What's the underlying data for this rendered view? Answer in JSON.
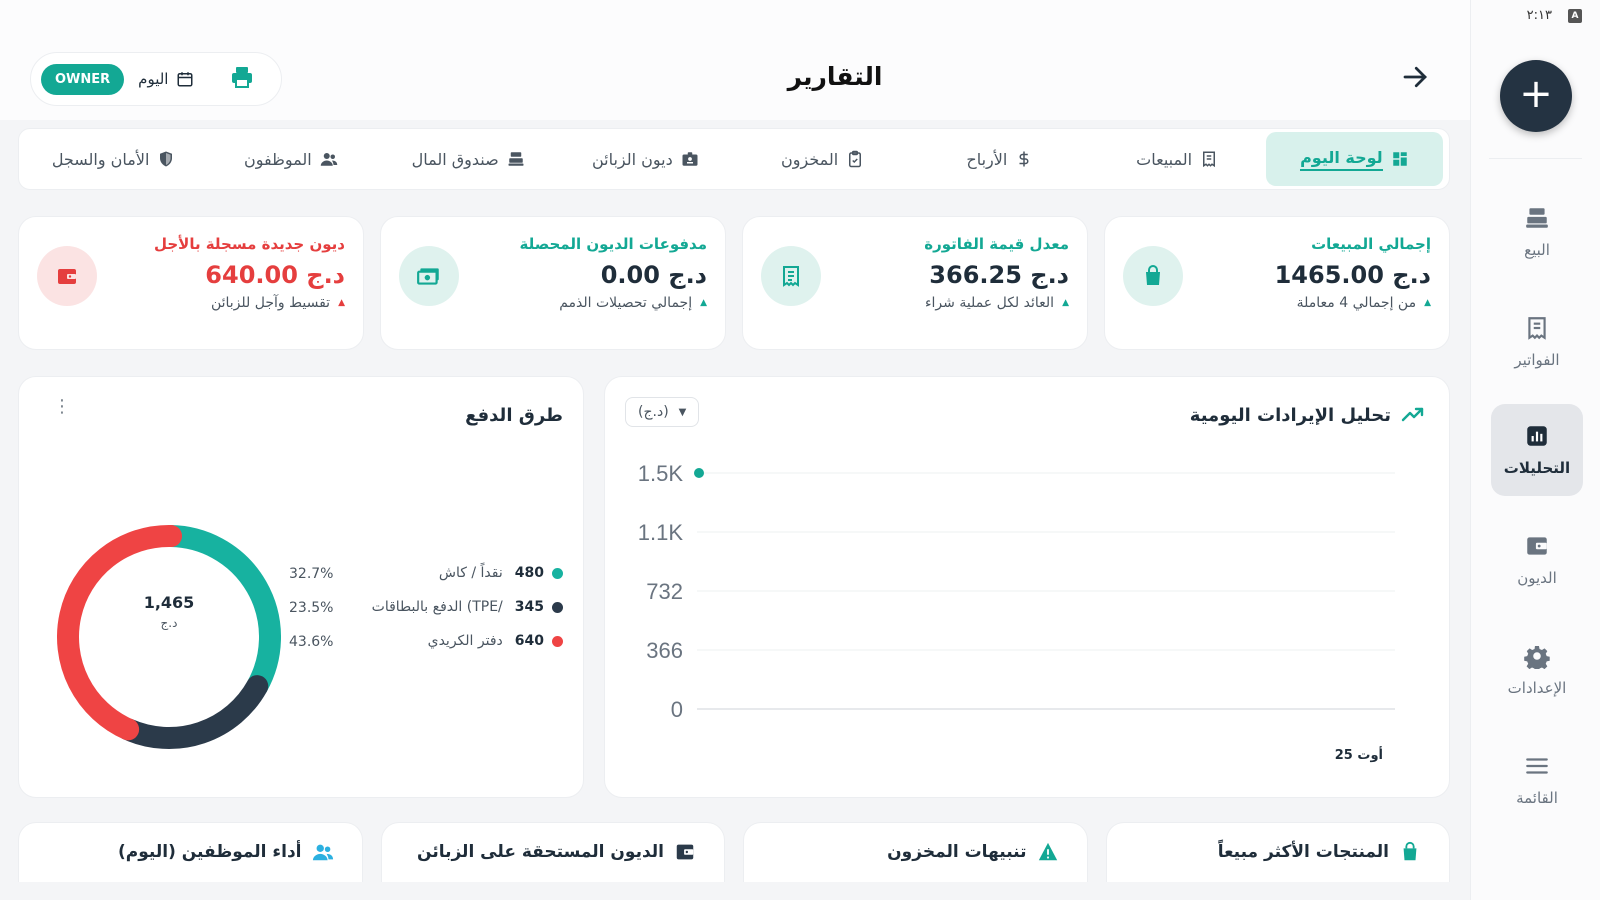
{
  "status_bar": {
    "time": "٢:١٣",
    "indicator": "A"
  },
  "header": {
    "title": "التقارير",
    "owner_badge": "OWNER",
    "date_filter": "اليوم"
  },
  "tabs": [
    {
      "label": "لوحة اليوم",
      "icon": "dashboard-icon",
      "active": true
    },
    {
      "label": "المبيعات",
      "icon": "receipt-icon",
      "active": false
    },
    {
      "label": "الأرباح",
      "icon": "dollar-icon",
      "active": false
    },
    {
      "label": "المخزون",
      "icon": "clipboard-check-icon",
      "active": false
    },
    {
      "label": "ديون الزبائن",
      "icon": "id-card-icon",
      "active": false
    },
    {
      "label": "صندوق المال",
      "icon": "cash-register-icon",
      "active": false
    },
    {
      "label": "الموظفون",
      "icon": "users-icon",
      "active": false
    },
    {
      "label": "الأمان والسجل",
      "icon": "shield-icon",
      "active": false
    }
  ],
  "kpis": [
    {
      "title": "إجمالي المبيعات",
      "value": "1465.00 د.ج",
      "sub": "من إجمالي 4 معاملة",
      "icon": "shopping-bag-icon",
      "tone": "green"
    },
    {
      "title": "معدل قيمة الفاتورة",
      "value": "366.25 د.ج",
      "sub": "العائد لكل عملية شراء",
      "icon": "invoice-icon",
      "tone": "green"
    },
    {
      "title": "مدفوعات الديون المحصلة",
      "value": "0.00 د.ج",
      "sub": "إجمالي تحصيلات الذمم",
      "icon": "money-icon",
      "tone": "green"
    },
    {
      "title": "ديون جديدة مسجلة بالأجل",
      "value": "640.00 د.ج",
      "sub": "تقسيط وآجل للزبائن",
      "icon": "wallet-icon",
      "tone": "red"
    }
  ],
  "revenue_panel": {
    "title": "تحليل الإيرادات اليومية",
    "unit_selector": "(د.ج)"
  },
  "payments_panel": {
    "title": "طرق الدفع",
    "total": "1,465",
    "currency": "د.ج",
    "legend": [
      {
        "label": "نقداً / كاش",
        "value": "480",
        "pct": "32.7%",
        "color": "#17b2a0"
      },
      {
        "label": "الدفع بالبطاقات (TPE/",
        "value": "345",
        "pct": "23.5%",
        "color": "#2b3a4a"
      },
      {
        "label": "دفتر الكريدي",
        "value": "640",
        "pct": "43.6%",
        "color": "#ef4444"
      }
    ]
  },
  "bottom_cards": [
    {
      "title": "المنتجات الأكثر مبيعاً",
      "icon": "shopping-bag-icon"
    },
    {
      "title": "تنبيهات المخزون",
      "icon": "warning-icon"
    },
    {
      "title": "الديون المستحقة على الزبائن",
      "icon": "wallet-icon"
    },
    {
      "title": "أداء الموظفين (اليوم)",
      "icon": "users-icon"
    }
  ],
  "rail": {
    "items": [
      {
        "label": "البيع",
        "icon": "cash-register-icon",
        "active": false
      },
      {
        "label": "الفواتير",
        "icon": "receipt-icon",
        "active": false
      },
      {
        "label": "التحليلات",
        "icon": "analytics-icon",
        "active": true
      },
      {
        "label": "الديون",
        "icon": "wallet-icon",
        "active": false
      },
      {
        "label": "الإعدادات",
        "icon": "gear-icon",
        "active": false
      },
      {
        "label": "القائمة",
        "icon": "menu-icon",
        "active": false
      }
    ]
  },
  "chart_data": {
    "type": "line",
    "title": "تحليل الإيرادات اليومية",
    "categories": [
      "25 أوت"
    ],
    "series": [
      {
        "values": [
          1465
        ]
      }
    ],
    "ytick_labels": [
      "0",
      "366",
      "732",
      "1.1K",
      "1.5K"
    ],
    "ylim": [
      0,
      1465
    ],
    "grid": true
  },
  "donut_data": {
    "type": "pie",
    "total_label": "1,465",
    "values": [
      480,
      345,
      640
    ],
    "colors": [
      "#17b2a0",
      "#2b3a4a",
      "#ef4444"
    ]
  }
}
